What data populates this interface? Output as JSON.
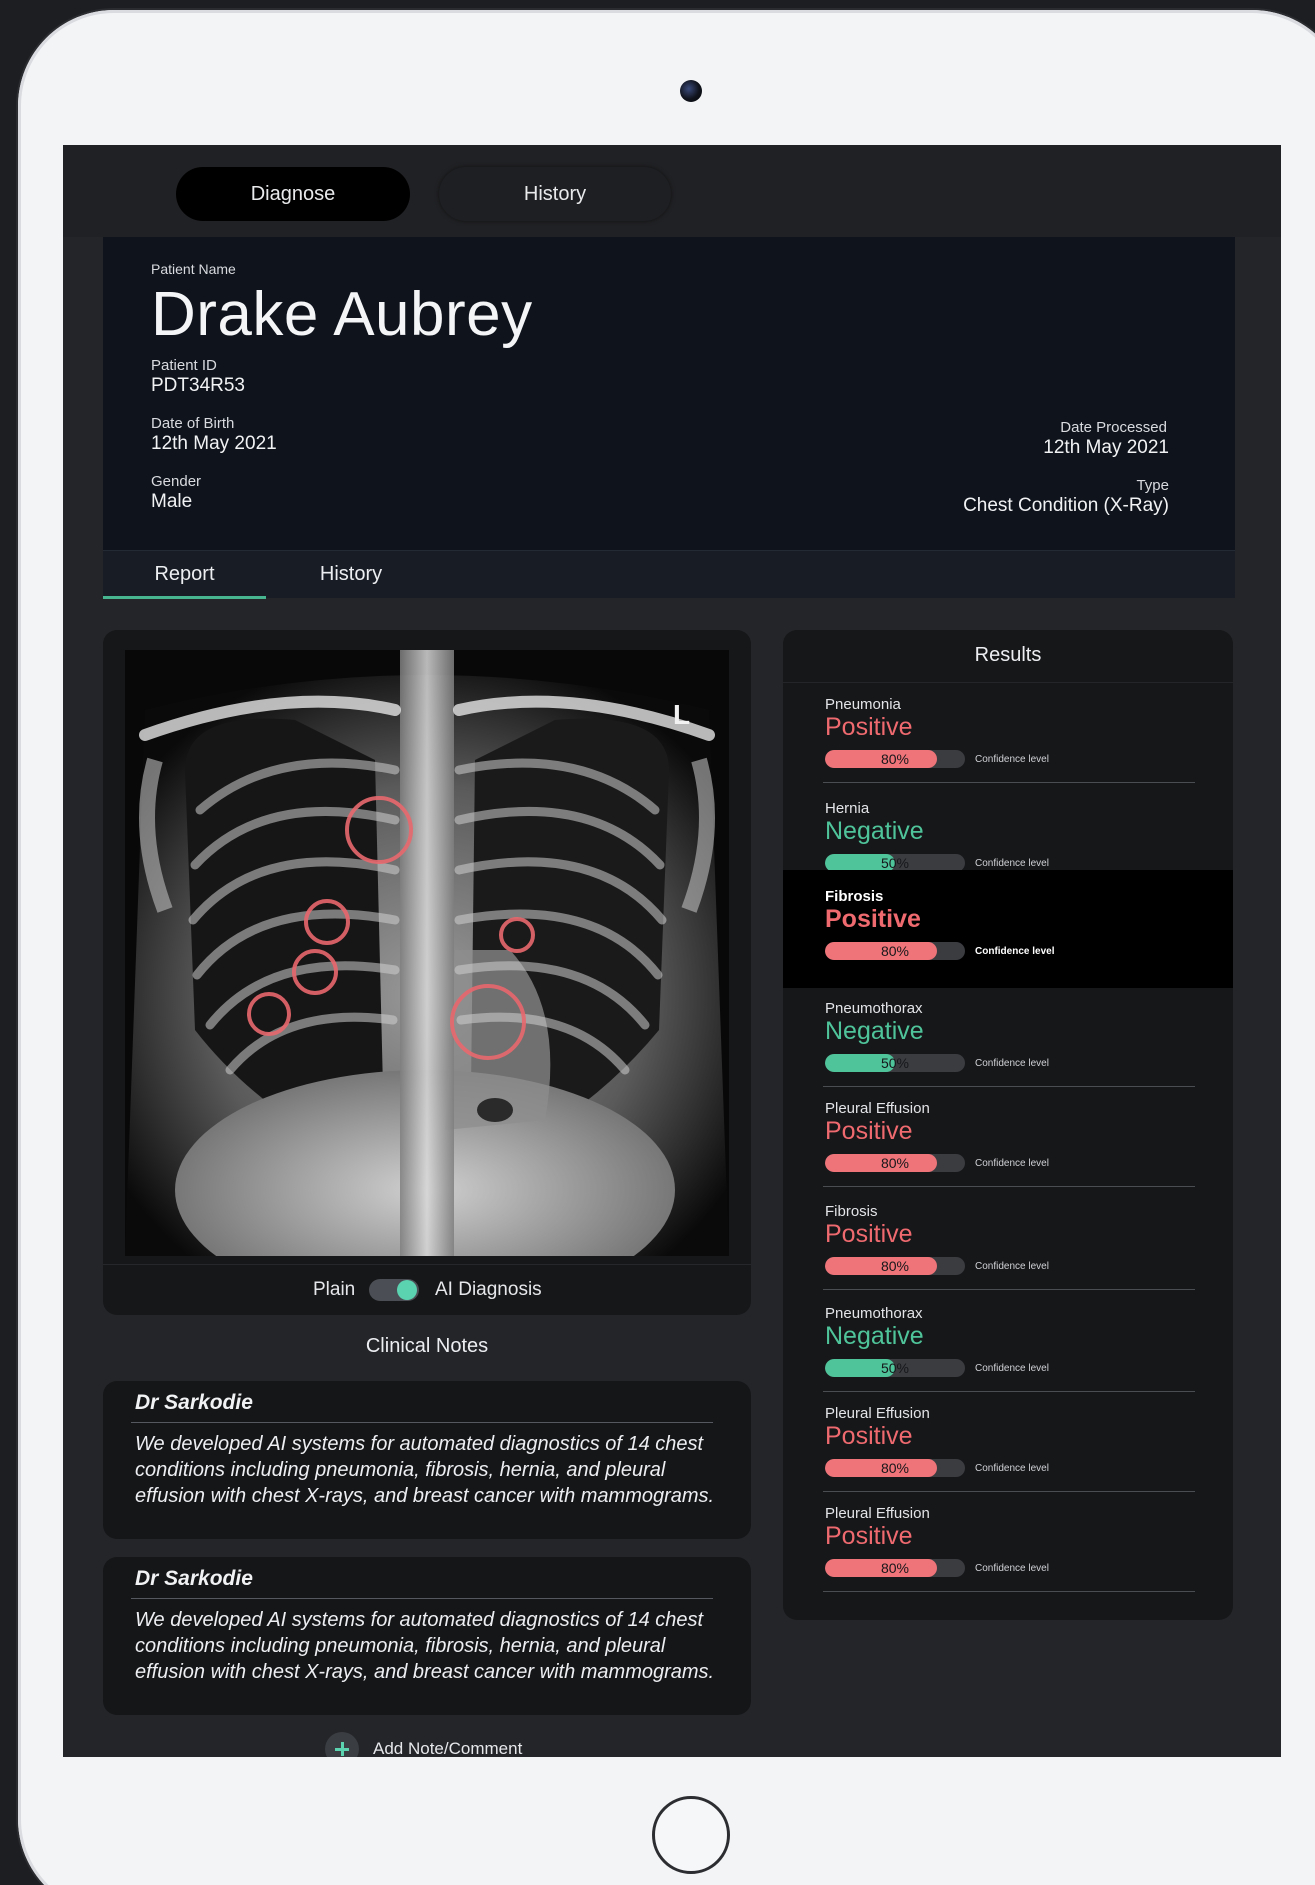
{
  "app": {
    "top_tabs": [
      {
        "label": "Diagnose",
        "active": true
      },
      {
        "label": "History",
        "active": false
      }
    ]
  },
  "patient": {
    "name_label": "Patient Name",
    "name": "Drake Aubrey",
    "id_label": "Patient ID",
    "id": "PDT34R53",
    "dob_label": "Date of Birth",
    "dob": "12th May 2021",
    "gender_label": "Gender",
    "gender": "Male",
    "processed_label": "Date Processed",
    "processed": "12th May 2021",
    "type_label": "Type",
    "type": "Chest Condition (X-Ray)"
  },
  "report_tabs": [
    {
      "label": "Report",
      "active": true
    },
    {
      "label": "History",
      "active": false
    }
  ],
  "xray": {
    "marker": "L",
    "toggle_left": "Plain",
    "toggle_right": "AI Diagnosis",
    "toggle_on": true,
    "highlight_color": "#e8686d"
  },
  "clinical_notes": {
    "title": "Clinical Notes",
    "notes": [
      {
        "author": "Dr Sarkodie",
        "text": "We developed AI systems for automated diagnostics of 14 chest conditions including pneumonia, fibrosis, hernia, and pleural effusion with chest X-rays, and breast cancer with mammograms."
      },
      {
        "author": "Dr Sarkodie",
        "text": "We developed AI systems for automated diagnostics of 14 chest conditions including pneumonia, fibrosis, hernia, and pleural effusion with chest X-rays, and breast cancer with mammograms."
      }
    ],
    "add_label": "Add Note/Comment"
  },
  "results": {
    "title": "Results",
    "confidence_label": "Confidence level",
    "colors": {
      "positive": "#ee6a6f",
      "negative": "#4fc49a"
    },
    "items": [
      {
        "condition": "Pneumonia",
        "status": "Positive",
        "confidence": 80,
        "confidence_text": "80%"
      },
      {
        "condition": "Hernia",
        "status": "Negative",
        "confidence": 50,
        "confidence_text": "50%"
      },
      {
        "condition": "Fibrosis",
        "status": "Positive",
        "confidence": 80,
        "confidence_text": "80%",
        "selected": true
      },
      {
        "condition": "Pneumothorax",
        "status": "Negative",
        "confidence": 50,
        "confidence_text": "50%"
      },
      {
        "condition": "Pleural Effusion",
        "status": "Positive",
        "confidence": 80,
        "confidence_text": "80%"
      },
      {
        "condition": "Fibrosis",
        "status": "Positive",
        "confidence": 80,
        "confidence_text": "80%"
      },
      {
        "condition": "Pneumothorax",
        "status": "Negative",
        "confidence": 50,
        "confidence_text": "50%"
      },
      {
        "condition": "Pleural Effusion",
        "status": "Positive",
        "confidence": 80,
        "confidence_text": "80%"
      },
      {
        "condition": "Pleural Effusion",
        "status": "Positive",
        "confidence": 80,
        "confidence_text": "80%"
      }
    ]
  }
}
